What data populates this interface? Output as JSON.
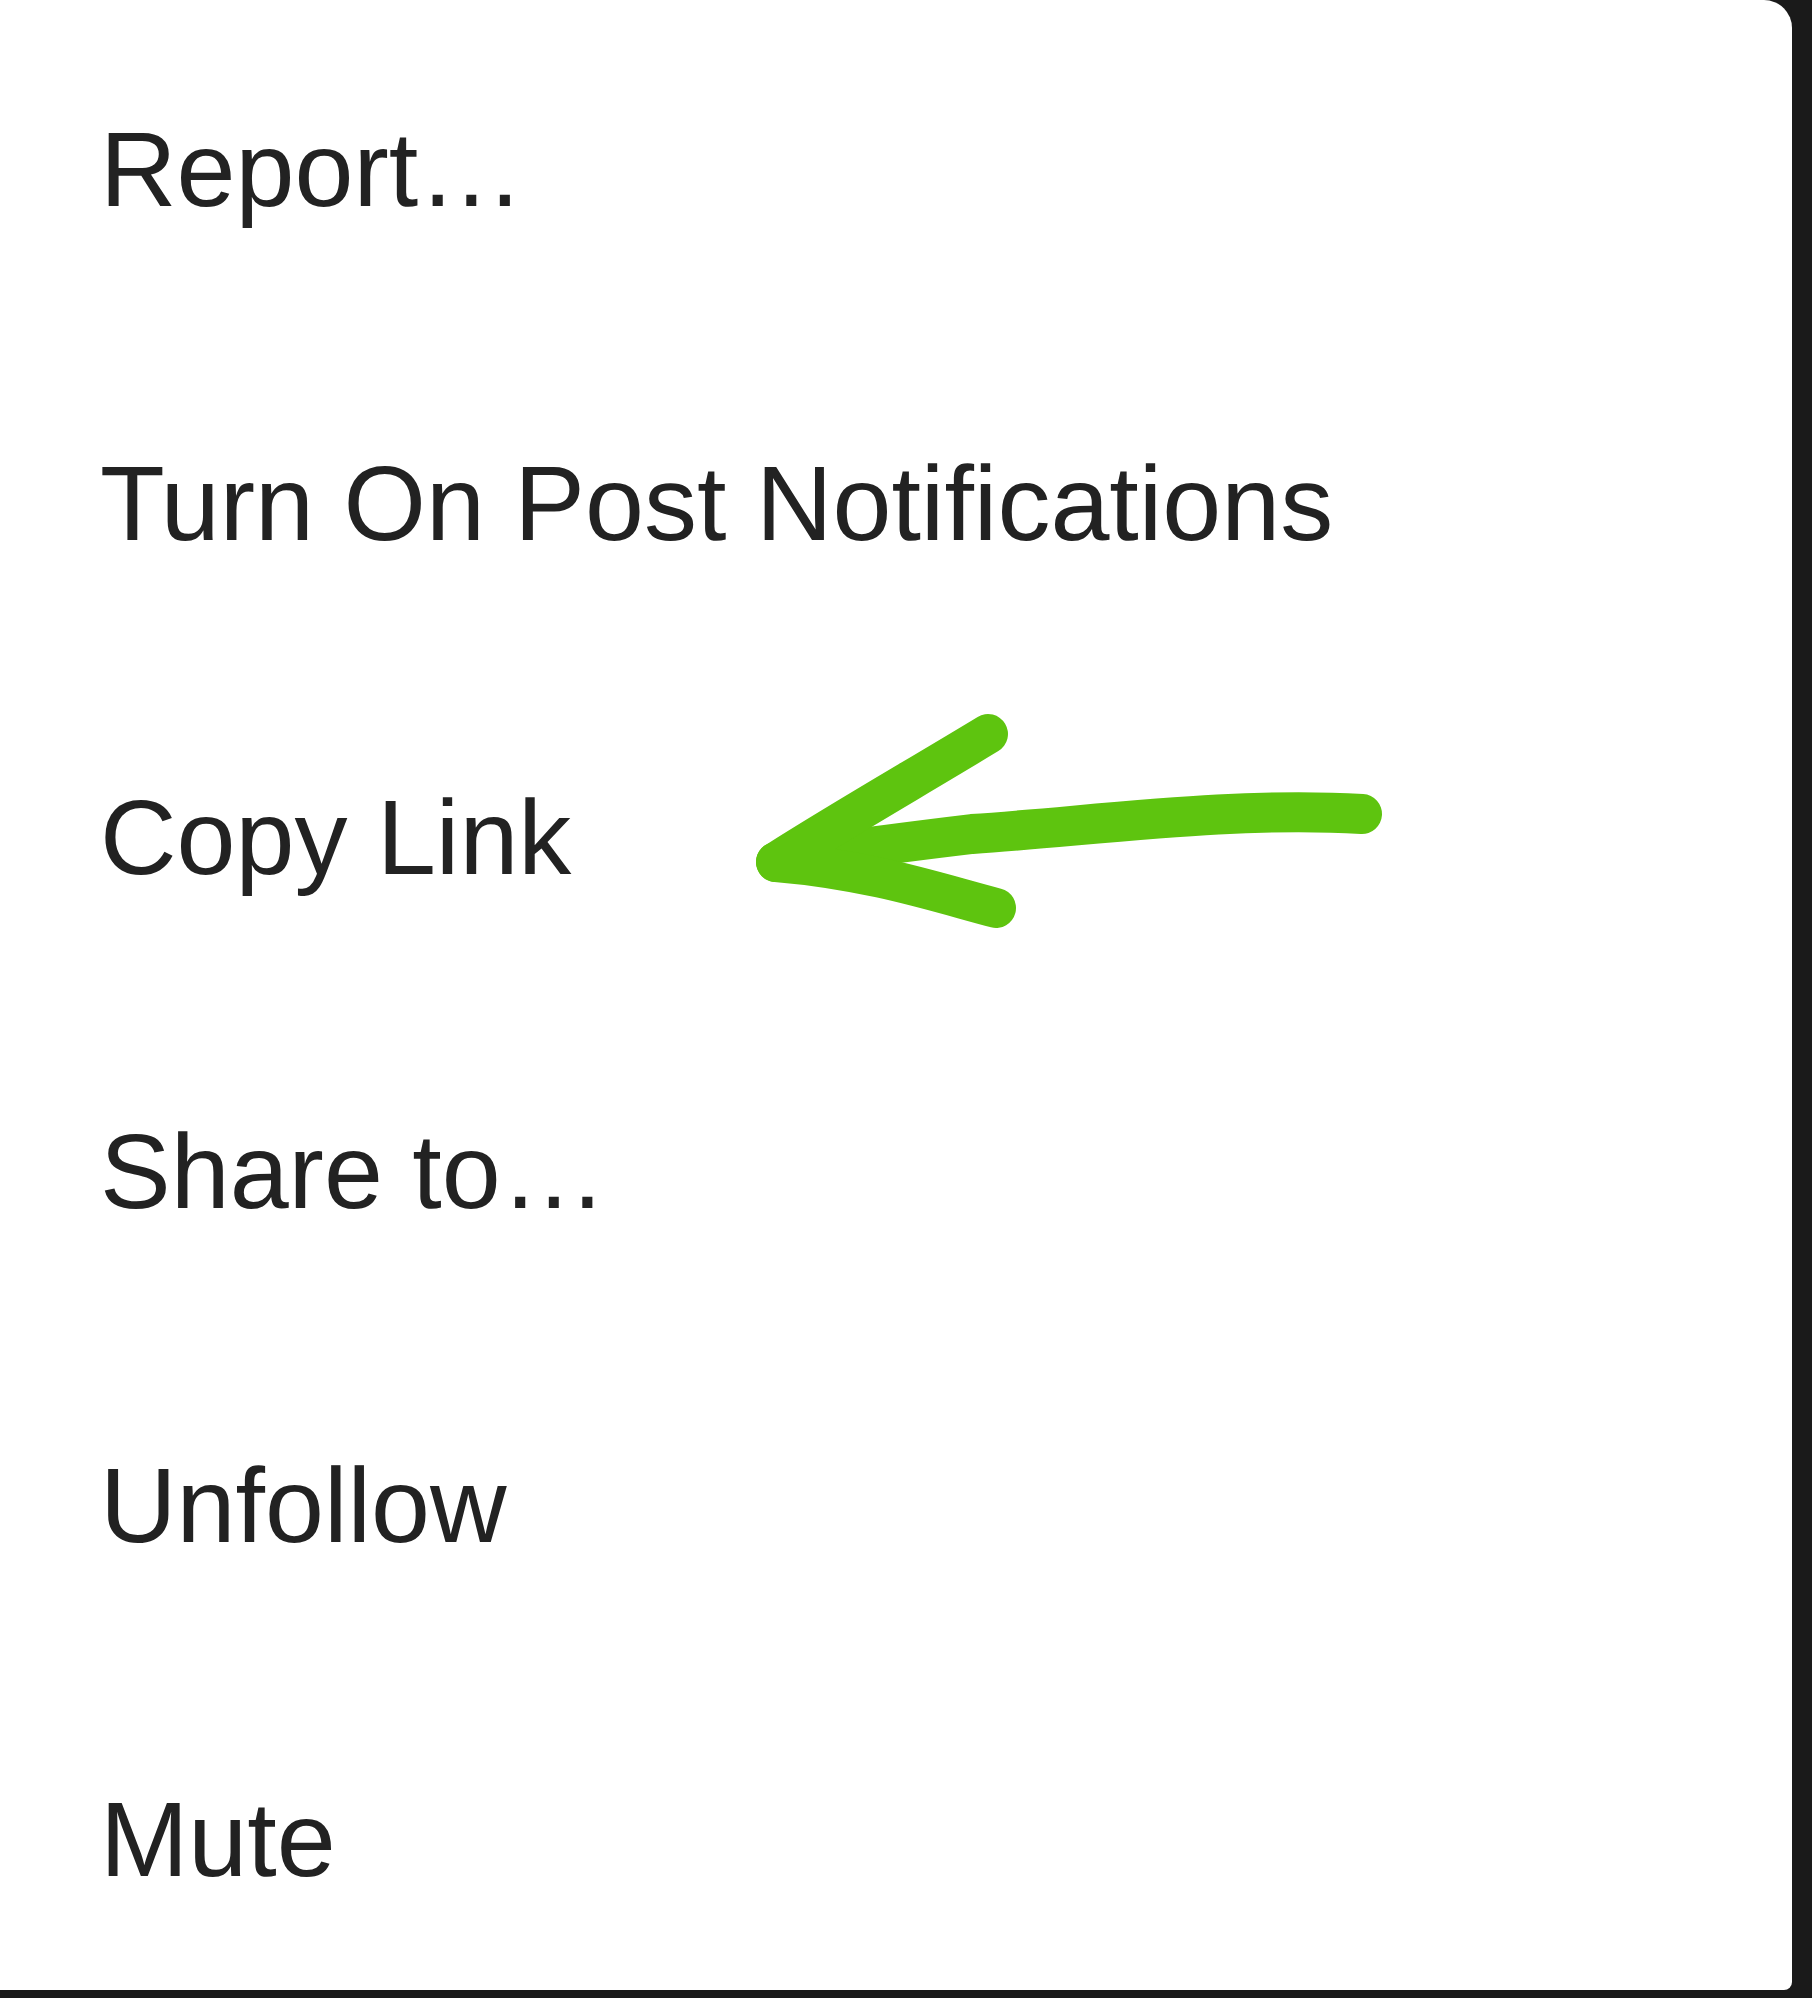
{
  "menu": {
    "items": [
      {
        "label": "Report…",
        "marked": false
      },
      {
        "label": "Turn On Post Notifications",
        "marked": false
      },
      {
        "label": "Copy Link",
        "marked": true
      },
      {
        "label": "Share to…",
        "marked": false
      },
      {
        "label": "Unfollow",
        "marked": false
      },
      {
        "label": "Mute",
        "marked": false
      }
    ]
  }
}
